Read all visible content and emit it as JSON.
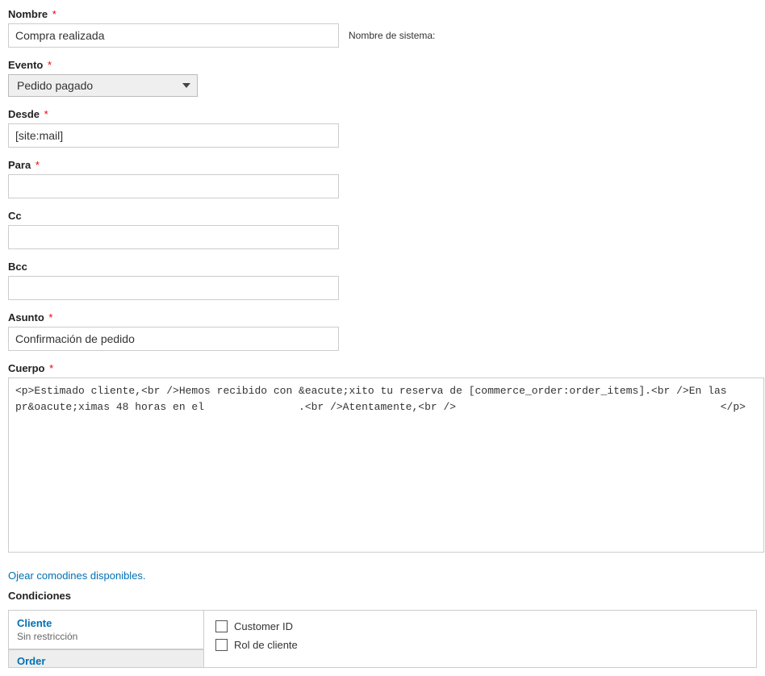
{
  "nombre": {
    "label": "Nombre",
    "value": "Compra realizada",
    "sys_label": "Nombre de sistema:"
  },
  "evento": {
    "label": "Evento",
    "value": "Pedido pagado"
  },
  "desde": {
    "label": "Desde",
    "value": "[site:mail]"
  },
  "para": {
    "label": "Para",
    "value": ""
  },
  "cc": {
    "label": "Cc",
    "value": ""
  },
  "bcc": {
    "label": "Bcc",
    "value": ""
  },
  "asunto": {
    "label": "Asunto",
    "value": "Confirmación de pedido"
  },
  "cuerpo": {
    "label": "Cuerpo",
    "value": "<p>Estimado cliente,<br />Hemos recibido con &eacute;xito tu reserva de [commerce_order:order_items].<br />En las pr&oacute;ximas 48 horas en el               .<br />Atentamente,<br />                                          </p>"
  },
  "tokens_link": "Ojear comodines disponibles.",
  "condiciones": {
    "heading": "Condiciones",
    "tabs": {
      "cliente": {
        "title": "Cliente",
        "sub": "Sin restricción"
      },
      "order": {
        "title": "Order"
      }
    },
    "checks": {
      "customer_id": "Customer ID",
      "rol_cliente": "Rol de cliente"
    }
  }
}
